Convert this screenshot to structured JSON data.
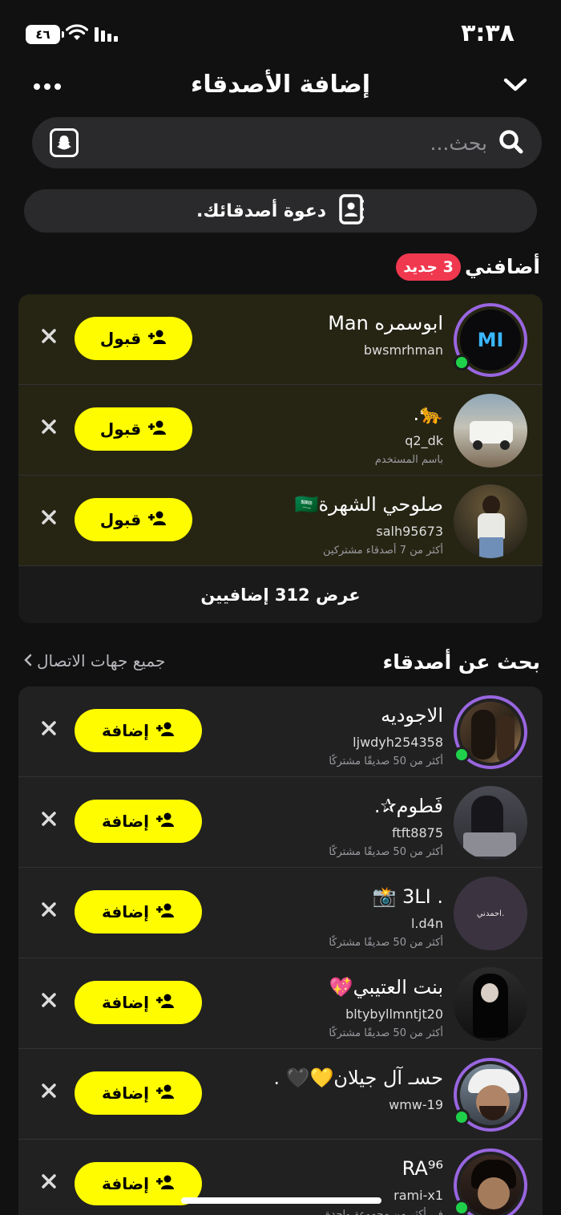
{
  "status_bar": {
    "time": "٣:٣٨",
    "battery": "٤٦"
  },
  "header": {
    "title": "إضافة الأصدقاء"
  },
  "search": {
    "placeholder": "بحث..."
  },
  "invite": {
    "label": "دعوة أصدقائك."
  },
  "added_me": {
    "title": "أضافني",
    "badge": "3 جديد",
    "view_all": "عرض 312 إضافيين",
    "rows": [
      {
        "display_name": "ابوسمره Man",
        "username": "bwsmrhman",
        "subtitle": "",
        "accept_label": "قبول",
        "avatar_text": "MI"
      },
      {
        "display_name": "🐆.",
        "username": "q2_dk",
        "subtitle": "باسم المستخدم",
        "accept_label": "قبول"
      },
      {
        "display_name": "صلوحي الشهرة🇸🇦",
        "username": "salh95673",
        "subtitle": "أكثر من 7 أصدقاء مشتركين",
        "accept_label": "قبول"
      }
    ]
  },
  "quick_add": {
    "title": "بحث عن أصدقاء",
    "all_contacts": "جميع جهات الاتصال",
    "rows": [
      {
        "display_name": "الاجوديه",
        "username": "ljwdyh254358",
        "subtitle": "أكثر من 50 صديقًا مشتركًا",
        "add_label": "إضافة"
      },
      {
        "display_name": "فَطوم✰.",
        "username": "ftft8875",
        "subtitle": "أكثر من 50 صديقًا مشتركًا",
        "add_label": "إضافة"
      },
      {
        "display_name": ". 3LI 📸",
        "username": "l.d4n",
        "subtitle": "أكثر من 50 صديقًا مشتركًا",
        "add_label": "إضافة",
        "avatar_text": "احمدني."
      },
      {
        "display_name": "بنت العتيبي💖",
        "username": "bltybyllmntjt20",
        "subtitle": "أكثر من 50 صديقًا مشتركًا",
        "add_label": "إضافة"
      },
      {
        "display_name": "حسـ آل جيلان💛🖤 .",
        "username": "wmw-19",
        "subtitle": "",
        "add_label": "إضافة"
      },
      {
        "display_name": "RA⁹⁶",
        "username": "rami-x1",
        "subtitle": "في أكثر من مجموعة واحدة",
        "add_label": "إضافة"
      }
    ]
  },
  "colors": {
    "accent_yellow": "#fffc00",
    "badge_red": "#f0384f",
    "story_ring": "#9966e0",
    "online_green": "#1fd14a"
  }
}
